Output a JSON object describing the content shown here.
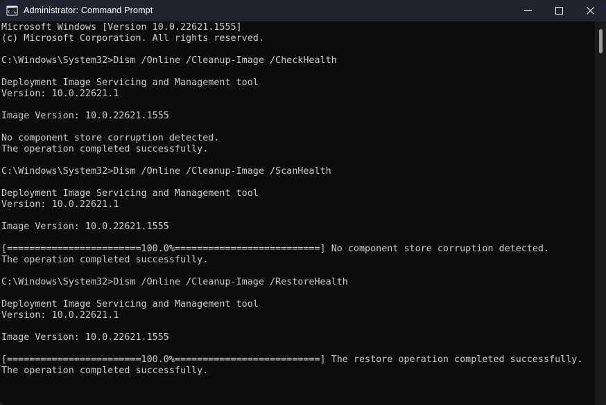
{
  "window": {
    "title": "Administrator: Command Prompt",
    "icon": "console-window-icon",
    "icon_label": "C:\\_",
    "titlebar_color": "#1f2430",
    "terminal_bg": "#0c0c0c",
    "terminal_fg": "#cccccc"
  },
  "controls": {
    "minimize": "—",
    "maximize": "□",
    "close": "✕",
    "minimize_name": "minimize-button",
    "maximize_name": "maximize-button",
    "close_name": "close-button"
  },
  "scrollbar": {
    "thumb_color": "#9b9b9b",
    "track_color": "#1a1a1a"
  },
  "terminal": {
    "prompt": "C:\\Windows\\System32>",
    "lines": [
      "Microsoft Windows [Version 10.0.22621.1555]",
      "(c) Microsoft Corporation. All rights reserved.",
      "",
      "C:\\Windows\\System32>Dism /Online /Cleanup-Image /CheckHealth",
      "",
      "Deployment Image Servicing and Management tool",
      "Version: 10.0.22621.1",
      "",
      "Image Version: 10.0.22621.1555",
      "",
      "No component store corruption detected.",
      "The operation completed successfully.",
      "",
      "C:\\Windows\\System32>Dism /Online /Cleanup-Image /ScanHealth",
      "",
      "Deployment Image Servicing and Management tool",
      "Version: 10.0.22621.1",
      "",
      "Image Version: 10.0.22621.1555",
      "",
      "[========================100.0%==========================] No component store corruption detected.",
      "The operation completed successfully.",
      "",
      "C:\\Windows\\System32>Dism /Online /Cleanup-Image /RestoreHealth",
      "",
      "Deployment Image Servicing and Management tool",
      "Version: 10.0.22621.1",
      "",
      "Image Version: 10.0.22621.1555",
      "",
      "[========================100.0%==========================] The restore operation completed successfully.",
      "The operation completed successfully."
    ],
    "commands": [
      "Dism /Online /Cleanup-Image /CheckHealth",
      "Dism /Online /Cleanup-Image /ScanHealth",
      "Dism /Online /Cleanup-Image /RestoreHealth"
    ],
    "progress_percent": "100.0%",
    "tool_name": "Deployment Image Servicing and Management tool",
    "tool_version": "10.0.22621.1",
    "image_version": "10.0.22621.1555",
    "os_version_line": "Microsoft Windows [Version 10.0.22621.1555]",
    "copyright_line": "(c) Microsoft Corporation. All rights reserved."
  }
}
